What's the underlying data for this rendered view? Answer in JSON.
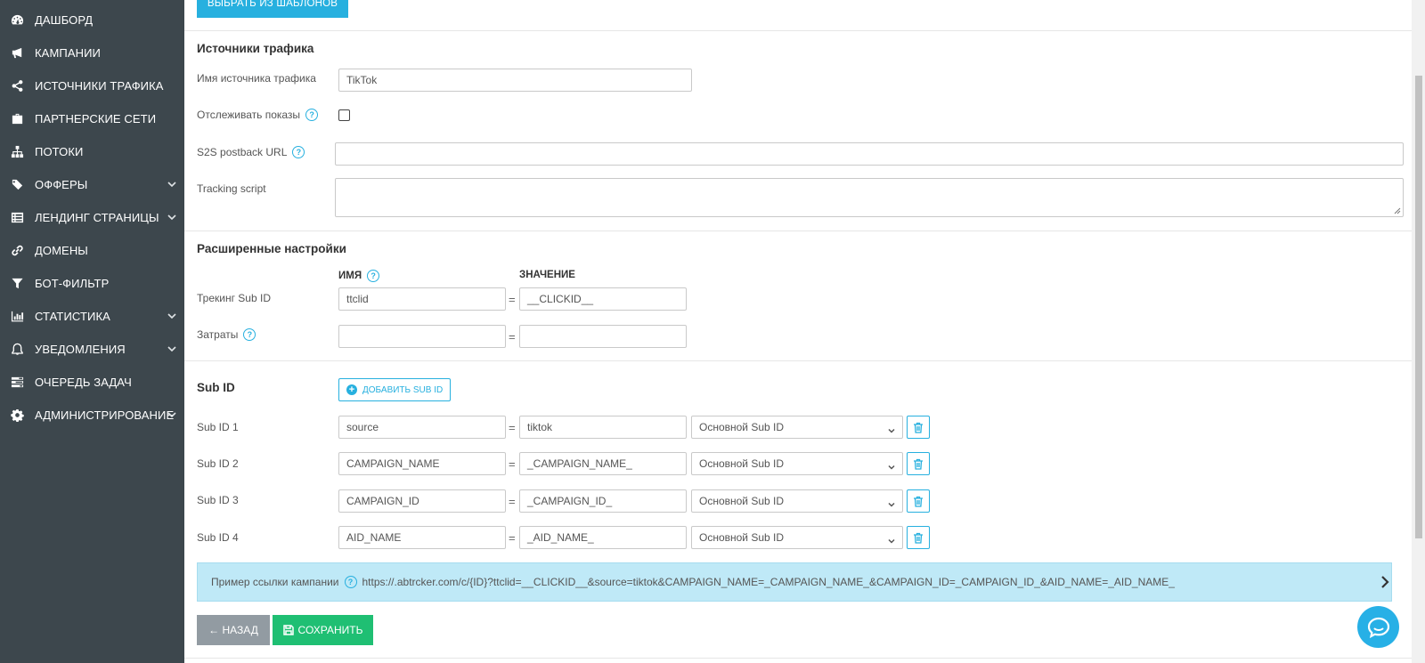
{
  "sidebar": {
    "items": [
      {
        "label": "ДАШБОРД",
        "icon": "dashboard-icon"
      },
      {
        "label": "КАМПАНИИ",
        "icon": "megaphone-icon"
      },
      {
        "label": "ИСТОЧНИКИ ТРАФИКА",
        "icon": "share-icon"
      },
      {
        "label": "ПАРТНЕРСКИЕ СЕТИ",
        "icon": "briefcase-icon"
      },
      {
        "label": "ПОТОКИ",
        "icon": "sitemap-icon"
      },
      {
        "label": "ОФФЕРЫ",
        "icon": "tags-icon"
      },
      {
        "label": "ЛЕНДИНГ СТРАНИЦЫ",
        "icon": "list-alt-icon"
      },
      {
        "label": "ДОМЕНЫ",
        "icon": "link-icon"
      },
      {
        "label": "БОТ-ФИЛЬТР",
        "icon": "filter-icon"
      },
      {
        "label": "СТАТИСТИКА",
        "icon": "bar-chart-icon"
      },
      {
        "label": "УВЕДОМЛЕНИЯ",
        "icon": "bell-icon"
      },
      {
        "label": "ОЧЕРЕДЬ ЗАДАЧ",
        "icon": "tasks-icon"
      },
      {
        "label": "АДМИНИСТРИРОВАНИЕ",
        "icon": "gear-icon"
      }
    ]
  },
  "template_button": "ВЫБРАТЬ ИЗ ШАБЛОНОВ",
  "traffic_sources": {
    "title": "Источники трафика",
    "name_label": "Имя источника трафика",
    "name_value": "TikTok",
    "track_impressions_label": "Отслеживать показы",
    "postback_label": "S2S postback URL",
    "postback_value": "",
    "tracking_script_label": "Tracking script"
  },
  "advanced": {
    "title": "Расширенные настройки",
    "col_name": "ИМЯ",
    "col_value": "ЗНАЧЕНИЕ",
    "tracking_subid_label": "Трекинг Sub ID",
    "tracking_subid_name": "ttclid",
    "tracking_subid_value": "__CLICKID__",
    "costs_label": "Затраты",
    "eq": "="
  },
  "subid": {
    "title": "Sub ID",
    "add_button": "ДОБАВИТЬ SUB ID",
    "rows": [
      {
        "label": "Sub ID 1",
        "name": "source",
        "value": "tiktok",
        "type": "Основной Sub ID"
      },
      {
        "label": "Sub ID 2",
        "name": "CAMPAIGN_NAME",
        "value": "_CAMPAIGN_NAME_",
        "type": "Основной Sub ID"
      },
      {
        "label": "Sub ID 3",
        "name": "CAMPAIGN_ID",
        "value": "_CAMPAIGN_ID_",
        "type": "Основной Sub ID"
      },
      {
        "label": "Sub ID 4",
        "name": "AID_NAME",
        "value": "_AID_NAME_",
        "type": "Основной Sub ID"
      }
    ]
  },
  "example": {
    "label": "Пример ссылки кампании",
    "url": "https://.abtrcker.com/c/{ID}?ttclid=__CLICKID__&source=tiktok&CAMPAIGN_NAME=_CAMPAIGN_NAME_&CAMPAIGN_ID=_CAMPAIGN_ID_&AID_NAME=_AID_NAME_"
  },
  "buttons": {
    "back": "← НАЗАД",
    "save": "СОХРАНИТЬ"
  },
  "colors": {
    "sidebar_bg": "#3d474d",
    "accent": "#27b0df",
    "save_green": "#1fbf73",
    "back_grey": "#929ba2",
    "info_bg": "#bfe9f7"
  }
}
